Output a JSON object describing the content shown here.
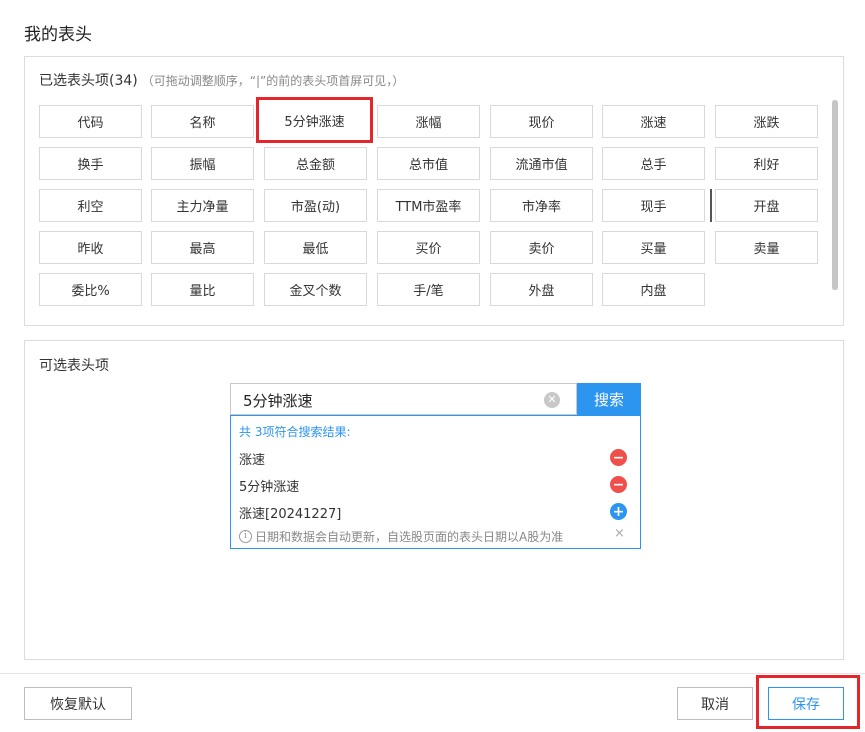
{
  "dialog": {
    "title": "我的表头"
  },
  "selected": {
    "heading": "已选表头项(34)",
    "hint": "（可拖动调整顺序，“|”的前的表头项首屏可见，）",
    "items": [
      "代码",
      "名称",
      "5分钟涨速",
      "涨幅",
      "现价",
      "涨速",
      "涨跌",
      "换手",
      "振幅",
      "总金额",
      "总市值",
      "流通市值",
      "总手",
      "利好",
      "利空",
      "主力净量",
      "市盈(动)",
      "TTM市盈率",
      "市净率",
      "现手",
      "开盘",
      "昨收",
      "最高",
      "最低",
      "买价",
      "卖价",
      "买量",
      "卖量",
      "委比%",
      "量比",
      "金叉个数",
      "手/笔",
      "外盘",
      "内盘"
    ],
    "highlighted_item": "5分钟涨速"
  },
  "available": {
    "heading": "可选表头项",
    "search": {
      "value": "5分钟涨速",
      "button_label": "搜索",
      "clear_icon": "clear-circle-icon"
    },
    "results": {
      "count_text": "共 3项符合搜索结果:",
      "items": [
        {
          "label": "涨速",
          "action": "remove"
        },
        {
          "label": "5分钟涨速",
          "action": "remove"
        },
        {
          "label": "涨速[20241227]",
          "action": "add"
        }
      ],
      "footer": "日期和数据会自动更新，自选股页面的表头日期以A股为准",
      "close_icon": "×"
    }
  },
  "buttons": {
    "restore": "恢复默认",
    "cancel": "取消",
    "save": "保存"
  },
  "colors": {
    "accent": "#2b95f0",
    "highlight": "#e3262b",
    "remove": "#f0504b"
  }
}
